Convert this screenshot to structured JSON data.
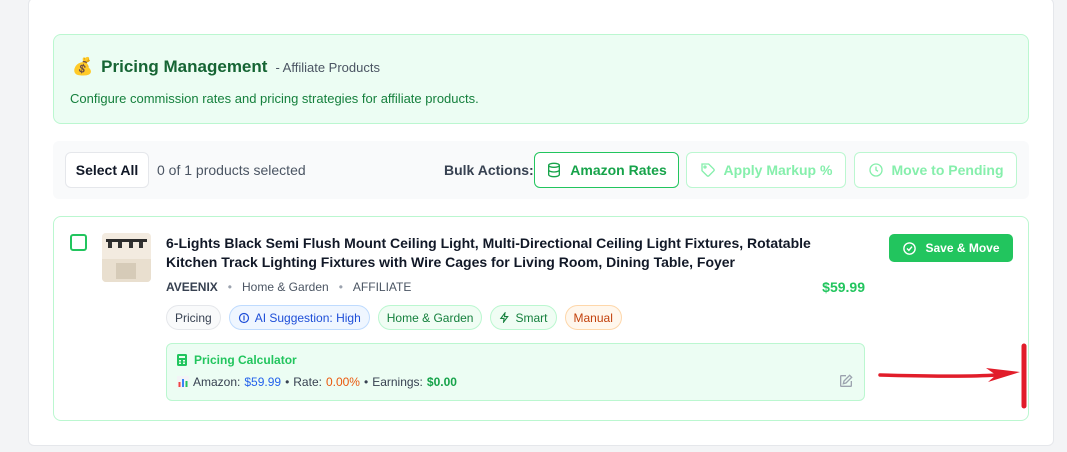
{
  "header": {
    "icon": "money-bag",
    "title": "Pricing Management",
    "subtitle": "- Affiliate Products",
    "description": "Configure commission rates and pricing strategies for affiliate products."
  },
  "bulk": {
    "select_all": "Select All",
    "selection_count": "0 of 1 products selected",
    "label": "Bulk Actions:",
    "actions": {
      "amazon": "Amazon Rates",
      "markup": "Apply Markup %",
      "pending": "Move to Pending"
    }
  },
  "product": {
    "title": "6-Lights Black Semi Flush Mount Ceiling Light, Multi-Directional Ceiling Light Fixtures, Rotatable Kitchen Track Lighting Fixtures with Wire Cages for Living Room, Dining Table, Foyer",
    "brand": "AVEENIX",
    "category": "Home & Garden",
    "type": "AFFILIATE",
    "price": "$59.99",
    "save_button": "Save & Move",
    "chips": {
      "pricing": "Pricing",
      "ai": "AI Suggestion: High",
      "category": "Home & Garden",
      "smart": "Smart",
      "manual": "Manual"
    },
    "calculator": {
      "title": "Pricing Calculator",
      "amazon_label": "Amazon:",
      "amazon_value": "$59.99",
      "sep1": "•",
      "rate_label": "Rate:",
      "rate_value": "0.00%",
      "sep2": "•",
      "earnings_label": "Earnings:",
      "earnings_value": "$0.00"
    }
  },
  "colors": {
    "accent": "#22c55e",
    "annotation_arrow": "#e11d2a"
  }
}
